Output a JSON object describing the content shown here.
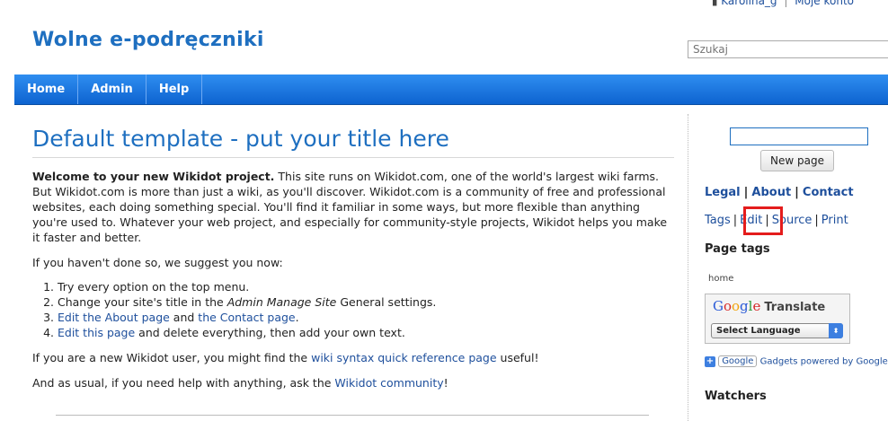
{
  "userbar": {
    "username": "Karolina_g",
    "account": "Moje konto"
  },
  "header": {
    "site_title": "Wolne e-podręczniki",
    "search_placeholder": "Szukaj"
  },
  "nav": {
    "items": [
      {
        "label": "Home"
      },
      {
        "label": "Admin"
      },
      {
        "label": "Help"
      }
    ]
  },
  "main": {
    "title": "Default template - put your title here",
    "intro_bold": "Welcome to your new Wikidot project.",
    "intro_text": " This site runs on Wikidot.com, one of the world's largest wiki farms. But Wikidot.com is more than just a wiki, as you'll discover. Wikidot.com is a community of free and professional websites, each doing something special. You'll find it familiar in some ways, but more flexible than anything you're used to. Whatever your web project, and especially for community-style projects, Wikidot helps you make it faster and better.",
    "suggest": "If you haven't done so, we suggest you now:",
    "steps": {
      "s1": "Try every option on the top menu.",
      "s2_a": "Change your site's title in the ",
      "s2_em": "Admin Manage Site",
      "s2_b": " General settings.",
      "s3_link1": "Edit the About page",
      "s3_and": " and ",
      "s3_link2": "the Contact page",
      "s3_end": ".",
      "s4_link": "Edit this page",
      "s4_text": " and delete everything, then add your own text."
    },
    "new_user_a": "If you are a new Wikidot user, you might find the ",
    "new_user_link": "wiki syntax quick reference page",
    "new_user_b": " useful!",
    "help_a": "And as usual, if you need help with anything, ask the ",
    "help_link": "Wikidot community",
    "help_b": "!"
  },
  "sidebar": {
    "new_page_button": "New page",
    "legal": "Legal",
    "about": "About",
    "contact": "Contact",
    "tools": {
      "tags": "Tags",
      "edit": "Edit",
      "source": "Source",
      "print": "Print"
    },
    "page_tags_heading": "Page tags",
    "tag": "home",
    "translate": {
      "select_label": "Select Language",
      "word": "Translate"
    },
    "powered_text": "Gadgets powered by Google",
    "google_badge": "Google",
    "watchers_heading": "Watchers"
  },
  "colors": {
    "accent": "#1e6fc0",
    "nav": "#0d63d0",
    "highlight": "#e41c1c"
  }
}
